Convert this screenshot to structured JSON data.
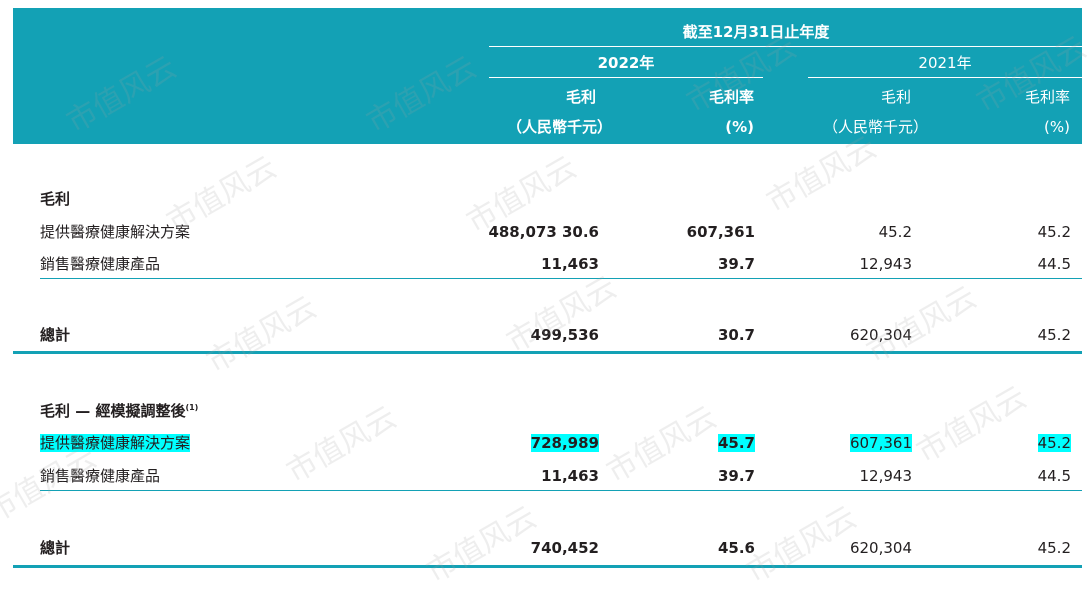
{
  "header": {
    "period": "截至12月31日止年度",
    "year_2022": "2022年",
    "year_2021": "2021年",
    "col_gp_2022": "毛利",
    "col_gpm_2022": "毛利率",
    "col_gp_2021": "毛利",
    "col_gpm_2021": "毛利率",
    "unit_gp_2022": "（人民幣千元）",
    "unit_gpm_2022": "(%)",
    "unit_gp_2021": "（人民幣千元）",
    "unit_gpm_2021": "(%)"
  },
  "section1": {
    "title": "毛利",
    "rows": [
      {
        "label": "提供醫療健康解決方案",
        "gp_2022": "488,073 30.6",
        "gpm_2022": "607,361",
        "gp_2021": "45.2",
        "gpm_2021": "45.2"
      },
      {
        "label": "銷售醫療健康產品",
        "gp_2022": "11,463",
        "gpm_2022": "39.7",
        "gp_2021": "12,943",
        "gpm_2021": "44.5"
      }
    ],
    "total": {
      "label": "總計",
      "gp_2022": "499,536",
      "gpm_2022": "30.7",
      "gp_2021": "620,304",
      "gpm_2021": "45.2"
    }
  },
  "section2": {
    "title": "毛利 — 經模擬調整後",
    "title_note": "(1)",
    "rows": [
      {
        "label": "提供醫療健康解決方案",
        "gp_2022": "728,989",
        "gpm_2022": "45.7",
        "gp_2021": "607,361",
        "gpm_2021": "45.2"
      },
      {
        "label": "銷售醫療健康產品",
        "gp_2022": "11,463",
        "gpm_2022": "39.7",
        "gp_2021": "12,943",
        "gpm_2021": "44.5"
      }
    ],
    "total": {
      "label": "總計",
      "gp_2022": "740,452",
      "gpm_2022": "45.6",
      "gp_2021": "620,304",
      "gpm_2021": "45.2"
    }
  },
  "watermark": "市值风云",
  "colors": {
    "header_bg": "#13a1b5",
    "highlight": "#00ffff",
    "rule": "#13a1b5"
  }
}
